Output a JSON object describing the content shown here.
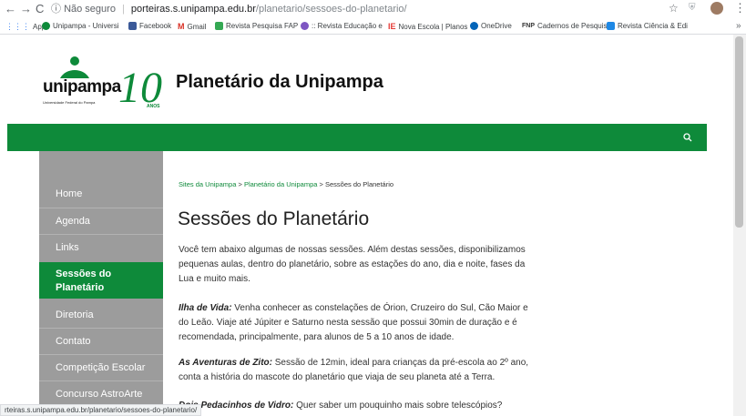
{
  "browser": {
    "security_label": "Não seguro",
    "url_host": "porteiras.s.unipampa.edu.br",
    "url_path": "/planetario/sessoes-do-planetario/",
    "bookmarks": [
      {
        "label": "Apps",
        "color": "#4285f4"
      },
      {
        "label": "Unipampa - Universi",
        "color": "#0e8a3a"
      },
      {
        "label": "Facebook",
        "color": "#3b5998"
      },
      {
        "label": "Gmail",
        "color": "#d93025"
      },
      {
        "label": "Revista Pesquisa FAP",
        "color": "#34a853"
      },
      {
        "label": ":: Revista Educação e",
        "color": "#7e57c2"
      },
      {
        "label": "Nova Escola | Planos",
        "color": "#e53935"
      },
      {
        "label": "OneDrive",
        "color": "#0364b8"
      },
      {
        "label": "Cadernos de Pesquis",
        "color": "#333333"
      },
      {
        "label": "Revista Ciência & Edi",
        "color": "#1e88e5"
      }
    ],
    "bookmark_prefixes": {
      "nova_escola": "IE",
      "cadernos": "FNP"
    },
    "status_url": "rteiras.s.unipampa.edu.br/planetario/sessoes-do-planetario/"
  },
  "header": {
    "logo_text": "unipampa",
    "logo_subtitle": "Universidade Federal do Pampa",
    "anniversary_number": "10",
    "anniversary_label": "ANOS",
    "site_title": "Planetário da Unipampa"
  },
  "sidebar": {
    "items": [
      {
        "label": "Home"
      },
      {
        "label": "Agenda"
      },
      {
        "label": "Links"
      },
      {
        "label": "Sessões do Planetário"
      },
      {
        "label": "Diretoria"
      },
      {
        "label": "Contato"
      },
      {
        "label": "Competição Escolar"
      },
      {
        "label": "Concurso AstroArte"
      }
    ]
  },
  "main": {
    "breadcrumb": {
      "link1": "Sites da Unipampa",
      "sep": ">",
      "link2": "Planetário da Unipampa",
      "current": "Sessões do Planetário"
    },
    "title": "Sessões do Planetário",
    "intro": "Você tem abaixo algumas de nossas sessões. Além destas sessões, disponibilizamos pequenas aulas, dentro do planetário, sobre as estações do ano, dia e noite, fases da Lua e muito mais.",
    "sessions": [
      {
        "name": "Ilha de Vida:",
        "text": " Venha conhecer as constelações de Órion, Cruzeiro do Sul, Cão Maior e do Leão. Viaje até Júpiter e Saturno nesta sessão que possui 30min de duração e é recomendada, principalmente, para alunos de 5 a 10 anos de idade."
      },
      {
        "name": "As Aventuras de Zito:",
        "text": " Sessão de 12min, ideal para crianças da pré-escola ao 2º ano, conta a história do mascote do planetário que viaja de seu planeta até a Terra."
      },
      {
        "name": "Dois Pedacinhos de Vidro:",
        "text": "  Quer saber um pouquinho mais sobre telescópios?"
      }
    ]
  },
  "colors": {
    "brand_green": "#0e8a3a",
    "sidebar_gray": "#9c9c9c"
  }
}
